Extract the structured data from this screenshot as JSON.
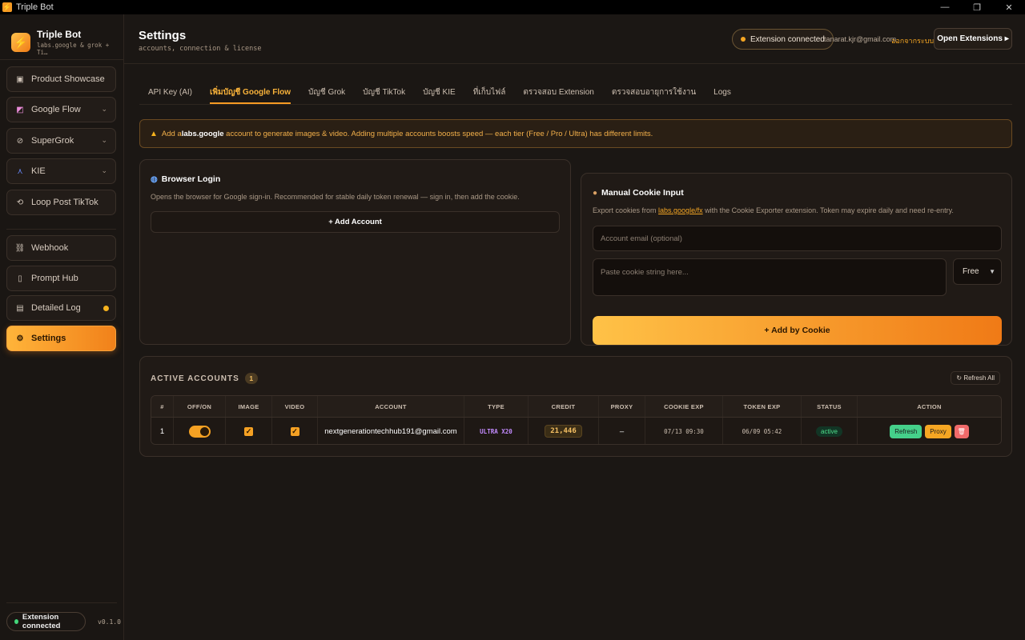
{
  "window": {
    "title": "Triple Bot",
    "app_icon": "bolt-icon",
    "controls": [
      "—",
      "❐",
      "✕"
    ]
  },
  "sidebar": {
    "brand_name": "Triple Bot",
    "brand_sub": "labs.google & grok + Ti…",
    "items": [
      {
        "label": "Product Showcase",
        "icon": "product-icon"
      },
      {
        "label": "Google Flow",
        "icon": "flow-icon",
        "expandable": true
      },
      {
        "label": "SuperGrok",
        "icon": "grok-icon",
        "expandable": true
      },
      {
        "label": "KIE",
        "icon": "kie-icon",
        "expandable": true
      },
      {
        "label": "Loop Post TikTok",
        "icon": "loop-icon"
      },
      {
        "label": "Webhook",
        "icon": "link-icon"
      },
      {
        "label": "Prompt Hub",
        "icon": "book-icon"
      },
      {
        "label": "Detailed Log",
        "icon": "document-icon",
        "indicator": true
      },
      {
        "label": "Settings",
        "icon": "gear-icon",
        "active": true
      }
    ],
    "extension_status": "Extension connected",
    "version": "v0.1.0"
  },
  "header": {
    "title": "Settings",
    "subtitle": "accounts, connection & license",
    "extension_status": "Extension connected",
    "email": "tanarat.kjr@gmail.com",
    "logout": "ออกจากระบบ",
    "open_extensions": "Open Extensions ▸"
  },
  "tabs": [
    {
      "label": "API Key (AI)"
    },
    {
      "label": "เพิ่มบัญชี Google Flow",
      "active": true
    },
    {
      "label": "บัญชี Grok"
    },
    {
      "label": "บัญชี TikTok"
    },
    {
      "label": "บัญชี KIE"
    },
    {
      "label": "ที่เก็บไฟล์"
    },
    {
      "label": "ตรวจสอบ Extension"
    },
    {
      "label": "ตรวจสอบอายุการใช้งาน"
    },
    {
      "label": "Logs"
    }
  ],
  "notice": {
    "before": "Add a ",
    "bold": "labs.google",
    "after": " account to generate images & video. Adding multiple accounts boosts speed — each tier (Free / Pro / Ultra) has different limits."
  },
  "browser_login": {
    "title": "Browser Login",
    "desc": "Opens the browser for Google sign-in. Recommended for stable daily token renewal — sign in, then add the cookie.",
    "button": "+ Add Account"
  },
  "manual_cookie": {
    "title": "Manual Cookie Input",
    "desc_before": "Export cookies from ",
    "desc_link": "labs.google/fx",
    "desc_after": " with the Cookie Exporter extension. Token may expire daily and need re-entry.",
    "email_placeholder": "Account email (optional)",
    "cookie_placeholder": "Paste cookie string here...",
    "tier_selected": "Free",
    "button": "+ Add by Cookie"
  },
  "accounts": {
    "title": "ACTIVE ACCOUNTS",
    "count": "1",
    "refresh_all": "↻ Refresh All",
    "columns": [
      "#",
      "OFF/ON",
      "IMAGE",
      "VIDEO",
      "ACCOUNT",
      "TYPE",
      "CREDIT",
      "PROXY",
      "COOKIE EXP",
      "TOKEN EXP",
      "STATUS",
      "ACTION"
    ],
    "rows": [
      {
        "index": "1",
        "enabled": true,
        "image": true,
        "video": true,
        "account": "nextgenerationtechhub191@gmail.com",
        "type": "ULTRA X20",
        "credit": "21,446",
        "proxy": "–",
        "cookie_exp": "07/13 09:30",
        "token_exp": "06/09 05:42",
        "status": "active",
        "actions": {
          "refresh": "Refresh",
          "proxy": "Proxy",
          "delete": "🗑"
        }
      }
    ]
  },
  "colors": {
    "accent": "#f59a23",
    "background": "#1b1714",
    "success": "#45d08a",
    "danger": "#ef6a6a"
  }
}
